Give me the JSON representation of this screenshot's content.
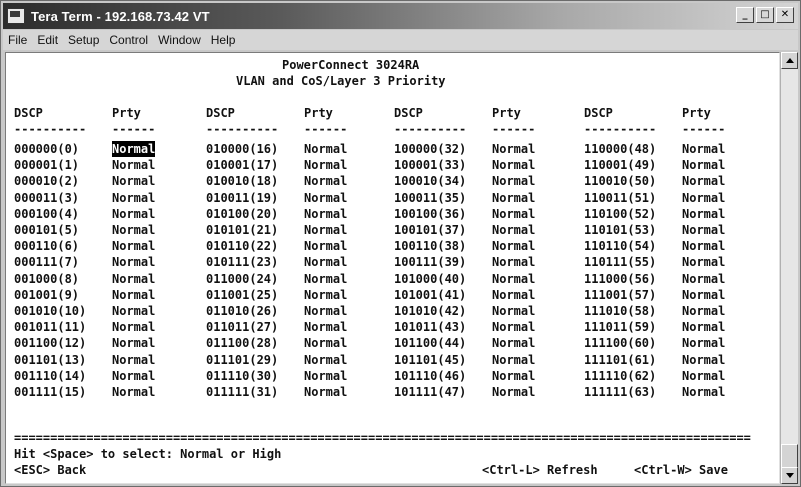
{
  "window": {
    "title": "Tera Term - 192.168.73.42 VT",
    "minimize": "_",
    "maximize": "□",
    "close": "✕"
  },
  "menu": [
    {
      "label": "File"
    },
    {
      "label": "Edit"
    },
    {
      "label": "Setup"
    },
    {
      "label": "Control"
    },
    {
      "label": "Window"
    },
    {
      "label": "Help"
    }
  ],
  "terminal": {
    "title": "PowerConnect 3024RA",
    "subtitle": "VLAN and CoS/Layer 3 Priority",
    "headers": [
      "DSCP",
      "Prty",
      "DSCP",
      "Prty",
      "DSCP",
      "Prty",
      "DSCP",
      "Prty"
    ],
    "dash_dscp": "----------",
    "dash_prty": "------",
    "selected_cell": "0-0",
    "rows": [
      [
        "000000(0)",
        "Normal",
        "010000(16)",
        "Normal",
        "100000(32)",
        "Normal",
        "110000(48)",
        "Normal"
      ],
      [
        "000001(1)",
        "Normal",
        "010001(17)",
        "Normal",
        "100001(33)",
        "Normal",
        "110001(49)",
        "Normal"
      ],
      [
        "000010(2)",
        "Normal",
        "010010(18)",
        "Normal",
        "100010(34)",
        "Normal",
        "110010(50)",
        "Normal"
      ],
      [
        "000011(3)",
        "Normal",
        "010011(19)",
        "Normal",
        "100011(35)",
        "Normal",
        "110011(51)",
        "Normal"
      ],
      [
        "000100(4)",
        "Normal",
        "010100(20)",
        "Normal",
        "100100(36)",
        "Normal",
        "110100(52)",
        "Normal"
      ],
      [
        "000101(5)",
        "Normal",
        "010101(21)",
        "Normal",
        "100101(37)",
        "Normal",
        "110101(53)",
        "Normal"
      ],
      [
        "000110(6)",
        "Normal",
        "010110(22)",
        "Normal",
        "100110(38)",
        "Normal",
        "110110(54)",
        "Normal"
      ],
      [
        "000111(7)",
        "Normal",
        "010111(23)",
        "Normal",
        "100111(39)",
        "Normal",
        "110111(55)",
        "Normal"
      ],
      [
        "001000(8)",
        "Normal",
        "011000(24)",
        "Normal",
        "101000(40)",
        "Normal",
        "111000(56)",
        "Normal"
      ],
      [
        "001001(9)",
        "Normal",
        "011001(25)",
        "Normal",
        "101001(41)",
        "Normal",
        "111001(57)",
        "Normal"
      ],
      [
        "001010(10)",
        "Normal",
        "011010(26)",
        "Normal",
        "101010(42)",
        "Normal",
        "111010(58)",
        "Normal"
      ],
      [
        "001011(11)",
        "Normal",
        "011011(27)",
        "Normal",
        "101011(43)",
        "Normal",
        "111011(59)",
        "Normal"
      ],
      [
        "001100(12)",
        "Normal",
        "011100(28)",
        "Normal",
        "101100(44)",
        "Normal",
        "111100(60)",
        "Normal"
      ],
      [
        "001101(13)",
        "Normal",
        "011101(29)",
        "Normal",
        "101101(45)",
        "Normal",
        "111101(61)",
        "Normal"
      ],
      [
        "001110(14)",
        "Normal",
        "011110(30)",
        "Normal",
        "101110(46)",
        "Normal",
        "111110(62)",
        "Normal"
      ],
      [
        "001111(15)",
        "Normal",
        "011111(31)",
        "Normal",
        "101111(47)",
        "Normal",
        "111111(63)",
        "Normal"
      ]
    ],
    "separator": "======================================================================================================",
    "hint": "Hit <Space> to select: Normal or High",
    "back": "<ESC> Back",
    "refresh": "<Ctrl-L> Refresh",
    "save": "<Ctrl-W> Save"
  }
}
